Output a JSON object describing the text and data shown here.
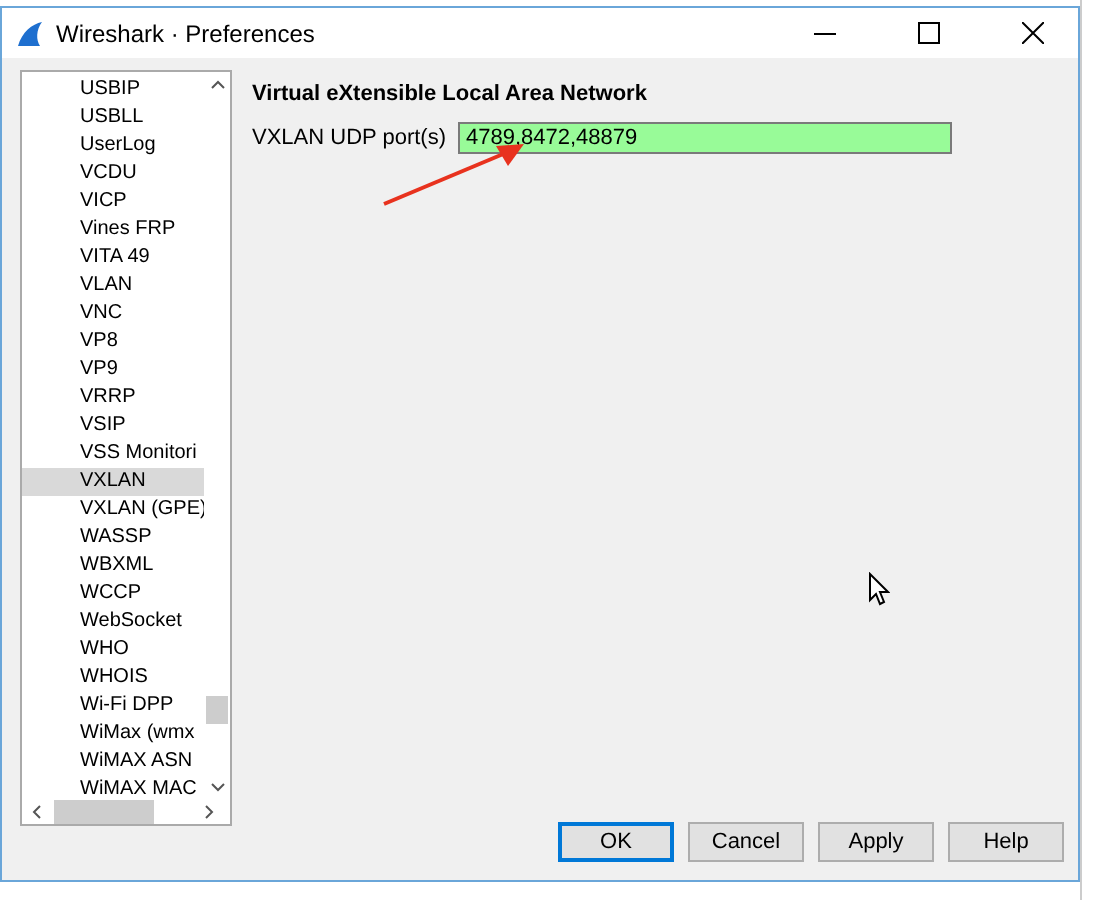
{
  "window": {
    "title": "Wireshark · Preferences"
  },
  "protocols": [
    {
      "label": "USBIP",
      "selected": false
    },
    {
      "label": "USBLL",
      "selected": false
    },
    {
      "label": "UserLog",
      "selected": false
    },
    {
      "label": "VCDU",
      "selected": false
    },
    {
      "label": "VICP",
      "selected": false
    },
    {
      "label": "Vines FRP",
      "selected": false
    },
    {
      "label": "VITA 49",
      "selected": false
    },
    {
      "label": "VLAN",
      "selected": false
    },
    {
      "label": "VNC",
      "selected": false
    },
    {
      "label": "VP8",
      "selected": false
    },
    {
      "label": "VP9",
      "selected": false
    },
    {
      "label": "VRRP",
      "selected": false
    },
    {
      "label": "VSIP",
      "selected": false
    },
    {
      "label": "VSS Monitori",
      "selected": false
    },
    {
      "label": "VXLAN",
      "selected": true
    },
    {
      "label": "VXLAN (GPE)",
      "selected": false
    },
    {
      "label": "WASSP",
      "selected": false
    },
    {
      "label": "WBXML",
      "selected": false
    },
    {
      "label": "WCCP",
      "selected": false
    },
    {
      "label": "WebSocket",
      "selected": false
    },
    {
      "label": "WHO",
      "selected": false
    },
    {
      "label": "WHOIS",
      "selected": false
    },
    {
      "label": "Wi-Fi DPP",
      "selected": false
    },
    {
      "label": "WiMax (wmx",
      "selected": false
    },
    {
      "label": "WiMAX ASN",
      "selected": false
    },
    {
      "label": "WiMAX MAC",
      "selected": false
    }
  ],
  "panel": {
    "heading": "Virtual eXtensible Local Area Network",
    "field": {
      "label": "VXLAN UDP port(s)",
      "value": "4789,8472,48879"
    }
  },
  "buttons": [
    {
      "label": "OK",
      "selected": true
    },
    {
      "label": "Cancel",
      "selected": false
    },
    {
      "label": "Apply",
      "selected": false
    },
    {
      "label": "Help",
      "selected": false
    }
  ]
}
